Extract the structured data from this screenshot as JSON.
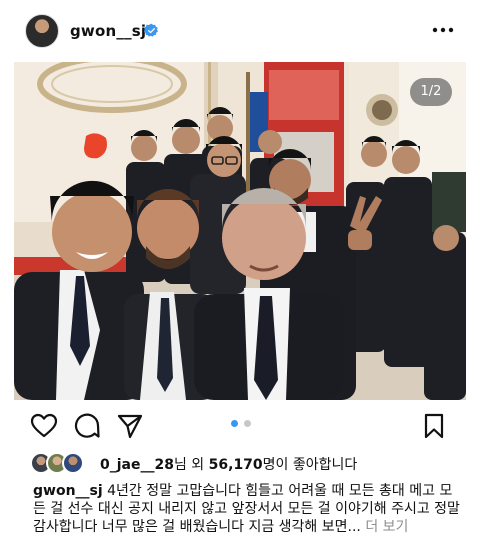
{
  "post": {
    "username": "gwon__sj",
    "verified": true,
    "more_icon": "more-horizontal-icon",
    "image_counter": "1/2",
    "carousel": {
      "count": 2,
      "active": 0
    }
  },
  "actions": {
    "like": "heart-icon",
    "comment": "comment-icon",
    "share": "send-icon",
    "save": "bookmark-icon"
  },
  "likes": {
    "liker": "0_jae__28",
    "middle": "님 외",
    "count": "56,170",
    "suffix": "명이 좋아합니다"
  },
  "caption": {
    "username": "gwon__sj",
    "text": "4년간 정말 고맙습니다 힘들고 어려울 때 모든 총대 메고 모든 걸 선수 대신 공지 내리지 않고 앞장서서 모든 걸 이야기해 주시고 정말 감사합니다 너무 많은 걸 배웠습니다 지금 생각해 보면...",
    "more": "더 보기"
  },
  "colors": {
    "accent": "#3897f0",
    "text": "#111111",
    "muted": "#8e8e8e"
  }
}
